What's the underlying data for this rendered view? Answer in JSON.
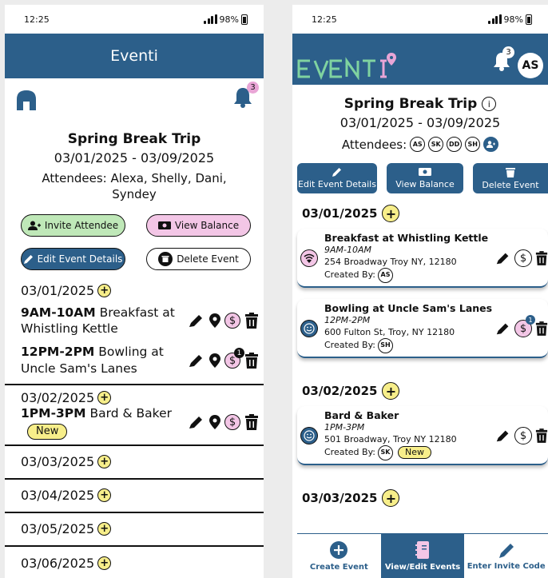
{
  "colors": {
    "primary": "#2c5f8a",
    "accent_yellow": "#f7ee8a",
    "accent_pink": "#f3c6e6",
    "accent_green": "#bfe8b8"
  },
  "left": {
    "status": {
      "time": "12:25",
      "battery": "98%"
    },
    "header": {
      "title": "Eventi"
    },
    "notifications": {
      "count": "3"
    },
    "trip": {
      "title": "Spring Break Trip",
      "dates": "03/01/2025 - 03/09/2025",
      "attendees": "Attendees: Alexa, Shelly, Dani, Syndey"
    },
    "buttons": {
      "invite": "Invite Attendee",
      "balance": "View Balance",
      "edit": "Edit Event Details",
      "delete": "Delete Event"
    },
    "days": [
      {
        "date": "03/01/2025"
      },
      {
        "date": "03/02/2025"
      },
      {
        "date": "03/03/2025"
      },
      {
        "date": "03/04/2025"
      },
      {
        "date": "03/05/2025"
      },
      {
        "date": "03/06/2025"
      }
    ],
    "events": [
      {
        "time": "9AM-10AM",
        "name": "Breakfast at Whistling Kettle"
      },
      {
        "time": "12PM-2PM",
        "name": "Bowling at Uncle Sam's Lanes",
        "badge": "1"
      },
      {
        "time": "1PM-3PM",
        "name": "Bard & Baker",
        "tag": "New"
      }
    ]
  },
  "right": {
    "status": {
      "time": "12:25",
      "battery": "98%"
    },
    "header": {
      "logo": "EVENTI",
      "notifications": "3",
      "avatar": "AS"
    },
    "trip": {
      "title": "Spring Break Trip",
      "dates": "03/01/2025 - 03/09/2025",
      "attendees_label": "Attendees:",
      "initials": [
        "AS",
        "SK",
        "DD",
        "SH"
      ]
    },
    "buttons": {
      "edit": "Edit Event Details",
      "balance": "View Balance",
      "delete": "Delete Event"
    },
    "days": [
      {
        "date": "03/01/2025"
      },
      {
        "date": "03/02/2025"
      },
      {
        "date": "03/03/2025"
      }
    ],
    "cards": [
      {
        "name": "Breakfast at Whistling Kettle",
        "time": "9AM-10AM",
        "address": "254 Broadway Troy NY, 12180",
        "created_label": "Created By:",
        "creator": "AS"
      },
      {
        "name": "Bowling at Uncle Sam's Lanes",
        "time": "12PM-2PM",
        "address": "600 Fulton St, Troy, NY 12180",
        "created_label": "Created By:",
        "creator": "SH",
        "badge": "1"
      },
      {
        "name": "Bard & Baker",
        "time": "1PM-3PM",
        "address": "501 Broadway, Troy NY 12180",
        "created_label": "Created By:",
        "creator": "SK",
        "tag": "New"
      }
    ],
    "nav": {
      "create": "Create Event",
      "view": "View/Edit Events",
      "invite": "Enter Invite Code"
    }
  }
}
